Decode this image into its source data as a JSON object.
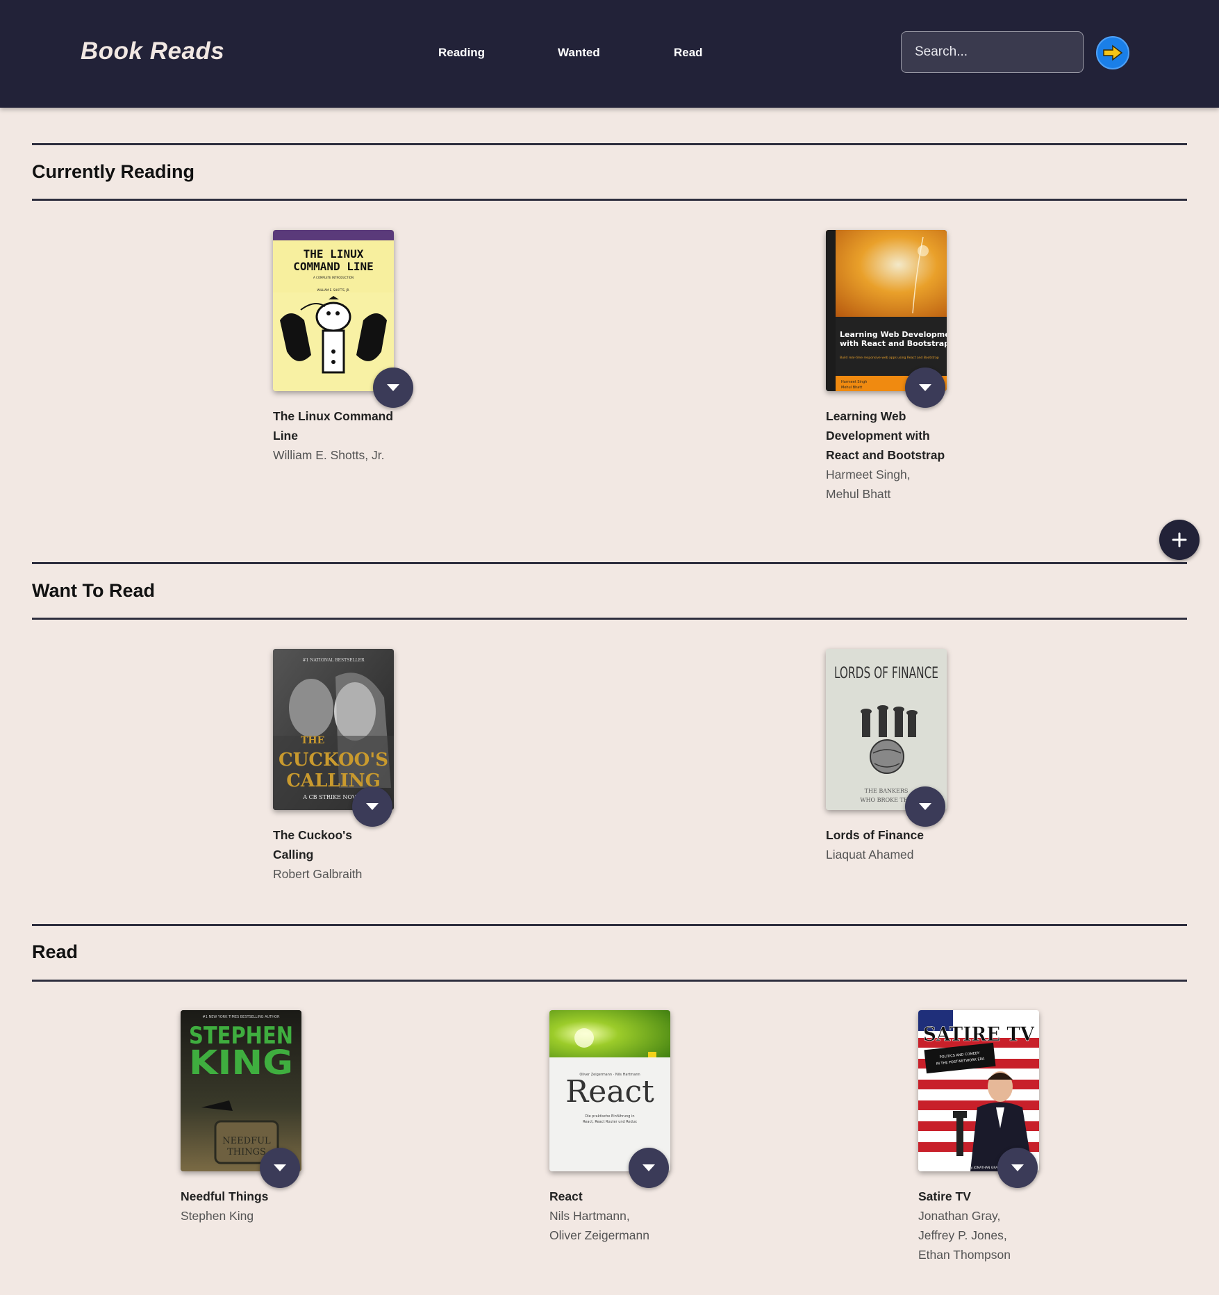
{
  "header": {
    "brand": "Book Reads",
    "nav": [
      {
        "label": "Reading"
      },
      {
        "label": "Wanted"
      },
      {
        "label": "Read"
      }
    ],
    "search_placeholder": "Search...",
    "search_button_icon": "arrow-right-icon"
  },
  "sections": [
    {
      "title": "Currently Reading",
      "books": [
        {
          "title": "The Linux Command Line",
          "authors": [
            "William E. Shotts, Jr."
          ],
          "cover_text": [
            "THE LINUX",
            "COMMAND LINE",
            "A COMPLETE INTRODUCTION",
            "WILLIAM E. SHOTTS, JR."
          ]
        },
        {
          "title": "Learning Web Development with React and Bootstrap",
          "authors": [
            "Harmeet Singh,",
            "Mehul Bhatt"
          ],
          "cover_text": [
            "Learning Web Development",
            "with React and Bootstrap",
            "Build real-time responsive web apps using React and Bootstrap",
            "Harmeet Singh",
            "Mehul Bhatt"
          ]
        }
      ]
    },
    {
      "title": "Want To Read",
      "books": [
        {
          "title": "The Cuckoo's Calling",
          "authors": [
            "Robert Galbraith"
          ],
          "cover_text": [
            "#1 NATIONAL BESTSELLER",
            "THE",
            "CUCKOO'S",
            "CALLING",
            "A CB STRIKE NOVEL"
          ]
        },
        {
          "title": "Lords of Finance",
          "authors": [
            "Liaquat Ahamed"
          ],
          "cover_text": [
            "LORDS OF FINANCE",
            "THE BANKERS",
            "WHO BROKE THE"
          ]
        }
      ]
    },
    {
      "title": "Read",
      "books": [
        {
          "title": "Needful Things",
          "authors": [
            "Stephen King"
          ],
          "cover_text": [
            "#1 NEW YORK TIMES BESTSELLING AUTHOR",
            "STEPHEN",
            "KING",
            "NEEDFUL",
            "THINGS"
          ]
        },
        {
          "title": "React",
          "authors": [
            "Nils Hartmann,",
            "Oliver Zeigermann"
          ],
          "cover_text": [
            "Oliver Zeigermann · Nils Hartmann",
            "React",
            "Die praktische Einführung in",
            "React, React Router und Redux"
          ]
        },
        {
          "title": "Satire TV",
          "authors": [
            "Jonathan Gray,",
            "Jeffrey P. Jones,",
            "Ethan Thompson"
          ],
          "cover_text": [
            "SATIRE TV",
            "POLITICS AND COMEDY",
            "IN THE POST-NETWORK ERA",
            "edited by JONATHAN GRAY"
          ]
        }
      ]
    }
  ],
  "colors": {
    "header_bg": "#222238",
    "page_bg": "#f2e8e3",
    "shelf_button": "#3b3b58",
    "search_button": "#1a7fe8",
    "arrow": "#f5c518"
  },
  "icons": {
    "shelf_changer": "caret-down-icon",
    "add": "plus-icon"
  }
}
